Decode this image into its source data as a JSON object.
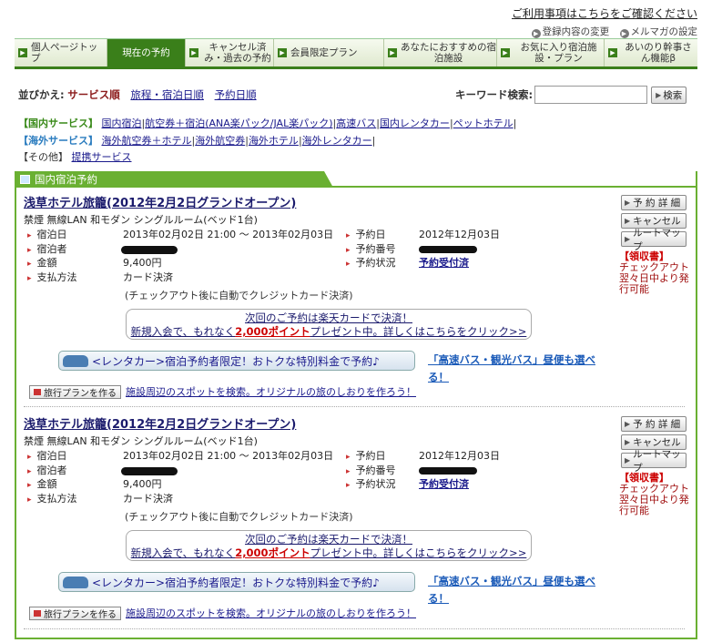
{
  "header": {
    "terms_link": "ご利用事項はこちらをご確認ください",
    "change_link": "登録内容の変更",
    "mail_link": "メルマガの設定"
  },
  "nav": {
    "tabs": [
      {
        "label": "個人ページトップ",
        "active": false
      },
      {
        "label": "現在の予約",
        "active": true
      },
      {
        "label": "キャンセル済み・過去の予約",
        "active": false
      },
      {
        "label": "会員限定プラン",
        "active": false
      },
      {
        "label": "あなたにおすすめの宿泊施設",
        "active": false
      },
      {
        "label": "お気に入り宿泊施設・プラン",
        "active": false
      },
      {
        "label": "あいのり幹事さん機能β",
        "active": false
      }
    ]
  },
  "sort": {
    "label": "並びかえ:",
    "current": "サービス順",
    "option1": "旅程・宿泊日順",
    "option2": "予約日順"
  },
  "keyword": {
    "label": "キーワード検索:",
    "value": "",
    "button": "検索"
  },
  "services": {
    "domestic_label": "【国内サービス】",
    "domestic": [
      "国内宿泊",
      "航空券＋宿泊(ANA楽パック/JAL楽パック)",
      "高速バス",
      "国内レンタカー",
      "ペットホテル"
    ],
    "overseas_label": "【海外サービス】",
    "overseas": [
      "海外航空券＋ホテル",
      "海外航空券",
      "海外ホテル",
      "海外レンタカー"
    ],
    "other_label": "【その他】",
    "other": [
      "提携サービス"
    ]
  },
  "section": {
    "title": "国内宿泊予約"
  },
  "reservations": [
    {
      "hotel": "浅草ホテル旅籠(2012年2月2日グランドオープン)",
      "room": "禁煙 無線LAN 和モダン シングルルーム(ベッド1台)",
      "checkin_label": "宿泊日",
      "checkin": "2013年02月02日 21:00 ～ 2013年02月03日",
      "guest_label": "宿泊者",
      "price_label": "金額",
      "price": "9,400円",
      "pay_label": "支払方法",
      "pay": "カード決済",
      "pay_note": "(チェックアウト後に自動でクレジットカード決済)",
      "date_label": "予約日",
      "date": "2012年12月03日",
      "number_label": "予約番号",
      "status_label": "予約状況",
      "status": "予約受付済",
      "buttons": [
        "予 約 詳 細",
        "キャンセル",
        "ルートマップ"
      ],
      "receipt_head": "【領収書】",
      "receipt_body": "チェックアウト翌々日中より発行可能"
    },
    {
      "hotel": "浅草ホテル旅籠(2012年2月2日グランドオープン)",
      "room": "禁煙 無線LAN 和モダン シングルルーム(ベッド1台)",
      "checkin_label": "宿泊日",
      "checkin": "2013年02月02日 21:00 ～ 2013年02月03日",
      "guest_label": "宿泊者",
      "price_label": "金額",
      "price": "9,400円",
      "pay_label": "支払方法",
      "pay": "カード決済",
      "pay_note": "(チェックアウト後に自動でクレジットカード決済)",
      "date_label": "予約日",
      "date": "2012年12月03日",
      "number_label": "予約番号",
      "status_label": "予約状況",
      "status": "予約受付済",
      "buttons": [
        "予 約 詳 細",
        "キャンセル",
        "ルートマップ"
      ],
      "receipt_head": "【領収書】",
      "receipt_body": "チェックアウト翌々日中より発行可能"
    }
  ],
  "promo": {
    "line1": "次回のご予約は楽天カードで決済！",
    "line2_a": "新規入会で、もれなく",
    "line2_b": "2,000ポイント",
    "line2_c": "プレゼント中。詳しくはこちらをクリック>>"
  },
  "rental": "<レンタカー>宿泊予約者限定！おトクな特別料金で予約♪",
  "bus": "「高速バス・観光バス」昼便も選べる！",
  "plan": {
    "button": "旅行プランを作る",
    "link": "施設周辺のスポットを検索。オリジナルの旅のしおりを作ろう！"
  }
}
